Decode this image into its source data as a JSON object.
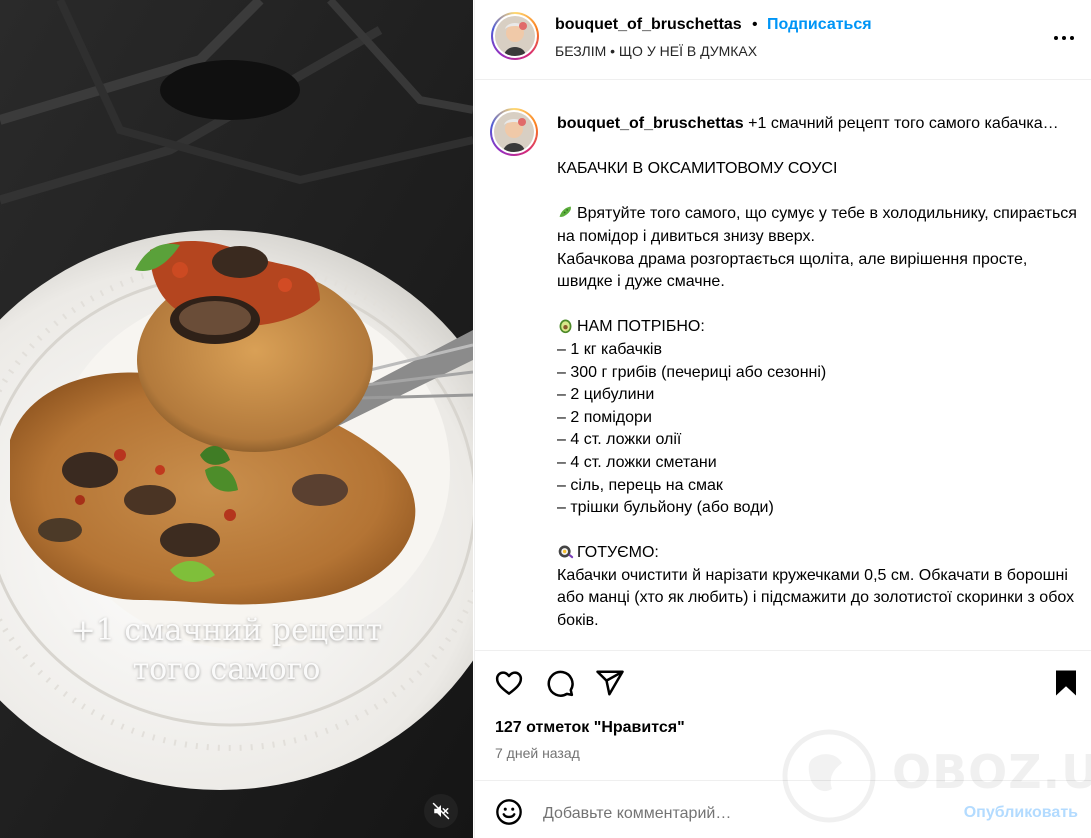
{
  "media": {
    "caption_line1": "+1 смачний рецепт",
    "caption_line2": "того самого",
    "mute_icon": "speaker-muted-icon"
  },
  "post_header": {
    "username": "bouquet_of_bruschettas",
    "separator": "•",
    "follow_label": "Подписаться",
    "subtitle": "БЕЗЛІМ • ЩО У НЕЇ В ДУМКАХ",
    "more_icon": "more-options-icon"
  },
  "caption": {
    "author": "bouquet_of_bruschettas",
    "lines": [
      "+1 смачний рецепт того самого кабачка…",
      "",
      "КАБАЧКИ В ОКСАМИТОВОМУ СОУСІ",
      "",
      "Врятуйте того самого, що сумує у тебе в холодильнику, спирається на помідор і дивиться знизу вверх.",
      "Кабачкова драма розгортається щоліта, але вирішення просте, швидке і дуже смачне.",
      "",
      "НАМ ПОТРІБНО:",
      "– 1 кг кабачків",
      "– 300 г грибів (печериці або сезонні)",
      "– 2 цибулини",
      "– 2 помідори",
      "– 4 ст. ложки олії",
      "– 4 ст. ложки сметани",
      "– сіль, перець на смак",
      "– трішки бульйону (або води)",
      "",
      "ГОТУЄМО:",
      "Кабачки очистити й нарізати кружечками 0,5 см. Обкачати в борошні або манці (хто як любить) і підсмажити до золотистої скоринки з обох боків."
    ]
  },
  "actions": {
    "like_icon": "heart-icon",
    "comment_icon": "comment-icon",
    "share_icon": "share-icon",
    "save_icon": "bookmark-icon"
  },
  "likes_text": "127 отметок \"Нравится\"",
  "date_text": "7 дней назад",
  "comment": {
    "placeholder": "Добавьте комментарий…",
    "publish_label": "Опубликовать",
    "emoji_icon": "smiley-icon"
  },
  "watermark": "OBOZ.UA",
  "colors": {
    "link_blue": "#0095f6",
    "publish_disabled": "#b3dbff",
    "secondary_text": "#737373"
  }
}
